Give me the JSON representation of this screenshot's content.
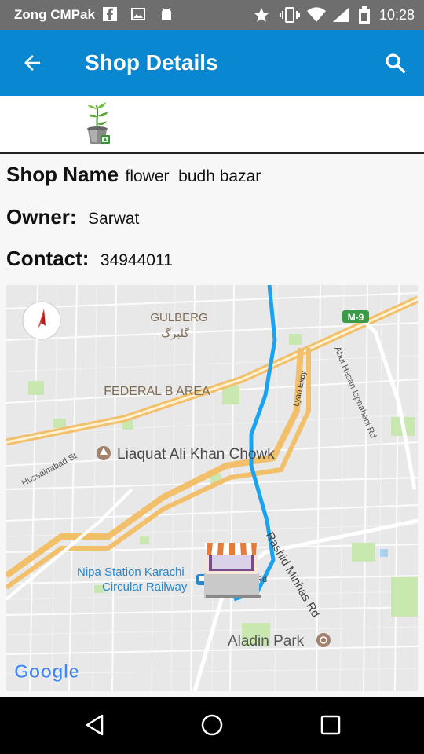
{
  "status_bar": {
    "carrier": "Zong CMPak",
    "time": "10:28",
    "icons": [
      "facebook-icon",
      "image-icon",
      "android-icon",
      "star-icon",
      "vibrate-icon",
      "wifi-icon",
      "signal-icon",
      "battery-icon"
    ]
  },
  "app_bar": {
    "title": "Shop Details",
    "back_icon": "arrow-back-icon",
    "search_icon": "search-icon"
  },
  "shop": {
    "name_label": "Shop Name",
    "name_value": "flower  budh bazar",
    "owner_label": "Owner:",
    "owner_value": "Sarwat",
    "contact_label": "Contact:",
    "contact_value": "34944011"
  },
  "map": {
    "labels": {
      "gulberg": "GULBERG",
      "gulberg_urdu": "گلبرگ",
      "federal_b_area": "FEDERAL B AREA",
      "liaquat": "Liaquat Ali Khan Chowk",
      "hussainabad": "Hussainabad St",
      "lyari": "Lyari Expy",
      "abul_hasan": "Abul Hasan Isphahani Rd",
      "m9": "M-9",
      "nipa_line1": "Nipa Station Karachi",
      "nipa_line2": "Circular Railway",
      "rashid": "Rashid Minhas Rd",
      "rd": "Rd",
      "aladin": "Aladin Park",
      "google": "Google"
    },
    "colors": {
      "route": "#1aa3f0",
      "highway": "#f2c06b",
      "park": "#c9e8b0",
      "water": "#a9d3f2"
    }
  },
  "nav_bar": {
    "back": "nav-back-icon",
    "home": "nav-home-icon",
    "recents": "nav-recents-icon"
  }
}
